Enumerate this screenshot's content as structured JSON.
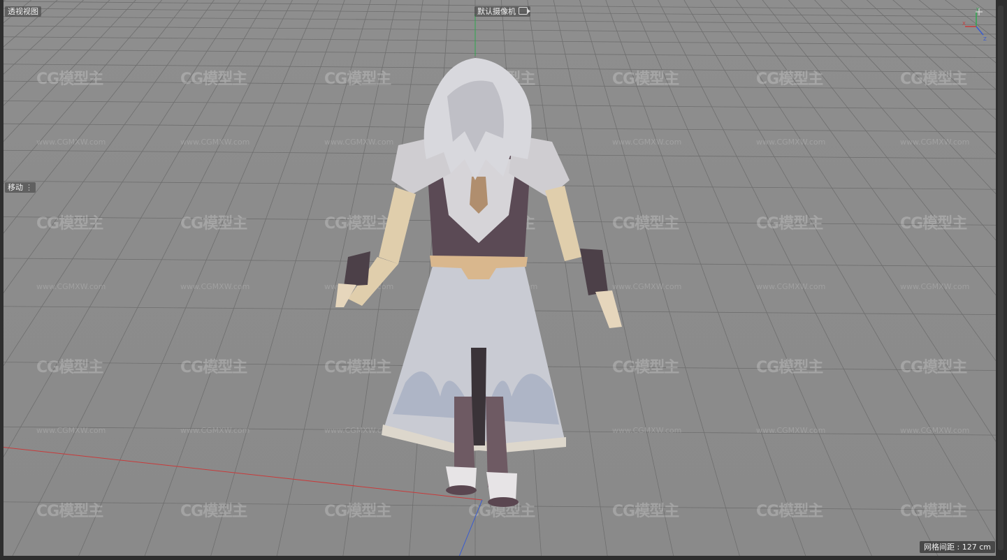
{
  "viewport": {
    "view_name": "透视视图",
    "camera_name": "默认摄像机",
    "camera_icon": "camera-icon",
    "tool_label": "移动",
    "tool_options_icon": "dots-icon",
    "grid_spacing": "网格间距 : 127 cm"
  },
  "watermark": {
    "logo_text": "CG模型主",
    "url_text": "www.CGMXW.com"
  },
  "colors": {
    "viewport_bg": "#8c8c8c",
    "grid_line": "#6e6e6e",
    "x_axis": "#c83a3a",
    "y_axis": "#2fa84f",
    "z_axis": "#3a5ccf"
  }
}
